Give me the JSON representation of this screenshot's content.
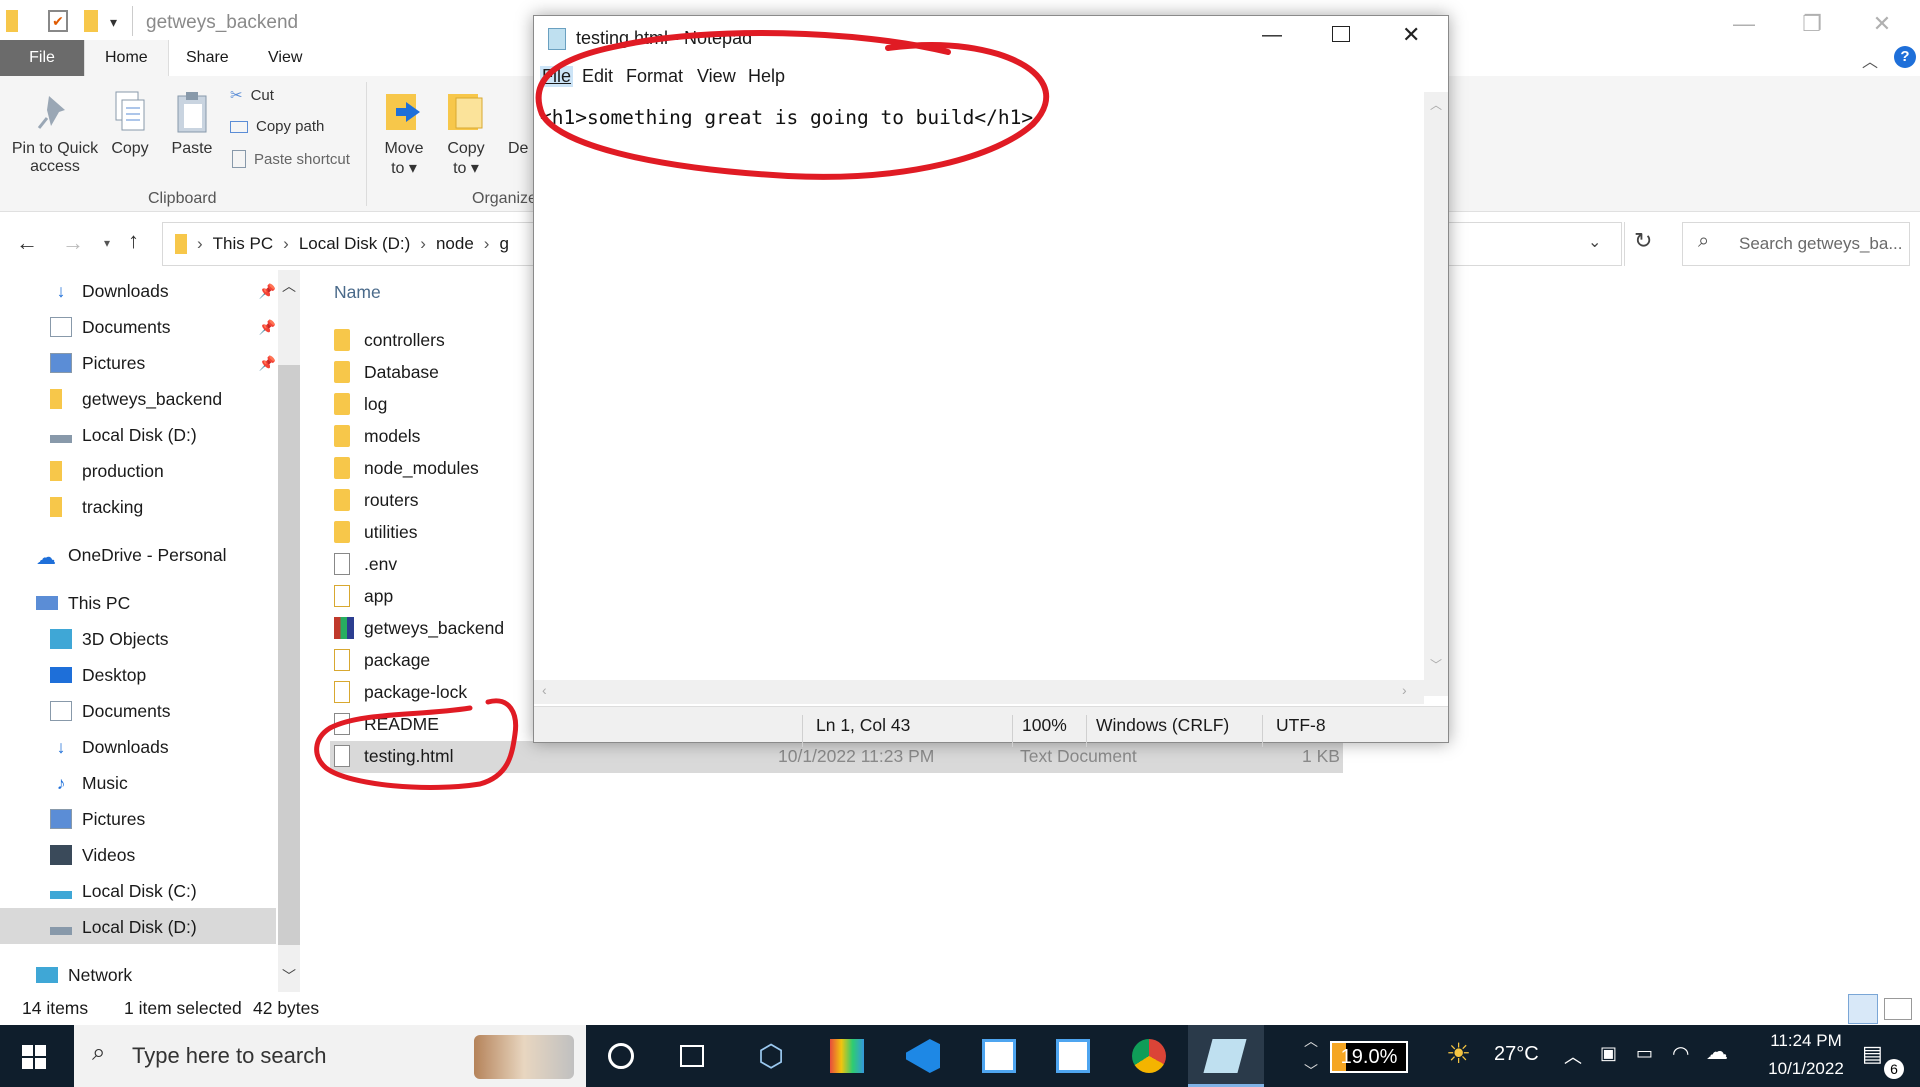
{
  "explorer": {
    "title": "getweys_backend",
    "tabs": {
      "file": "File",
      "home": "Home",
      "share": "Share",
      "view": "View"
    },
    "ribbon": {
      "pin": "Pin to Quick\naccess",
      "pin_l1": "Pin to Quick",
      "pin_l2": "access",
      "copy": "Copy",
      "paste": "Paste",
      "cut": "Cut",
      "copy_path": "Copy path",
      "paste_shortcut": "Paste shortcut",
      "clipboard": "Clipboard",
      "move_l1": "Move",
      "move_l2": "to",
      "copy_to_l1": "Copy",
      "copy_to_l2": "to",
      "de": "De",
      "organize": "Organize"
    },
    "address": {
      "this_pc": "This PC",
      "disk": "Local Disk (D:)",
      "node": "node",
      "g": "g"
    },
    "search_placeholder": "Search getweys_ba...",
    "nav": {
      "downloads": "Downloads",
      "documents": "Documents",
      "pictures": "Pictures",
      "getweys_backend": "getweys_backend",
      "local_d": "Local Disk (D:)",
      "production": "production",
      "tracking": "tracking",
      "onedrive": "OneDrive - Personal",
      "this_pc": "This PC",
      "objects3d": "3D Objects",
      "desktop": "Desktop",
      "documents2": "Documents",
      "downloads2": "Downloads",
      "music": "Music",
      "pictures2": "Pictures",
      "videos": "Videos",
      "local_c": "Local Disk (C:)",
      "local_d2": "Local Disk (D:)",
      "network": "Network"
    },
    "column_name": "Name",
    "files": [
      "controllers",
      "Database",
      "log",
      "models",
      "node_modules",
      "routers",
      "utilities",
      ".env",
      "app",
      "getweys_backend",
      "package",
      "package-lock",
      "README",
      "testing.html"
    ],
    "selected_details": {
      "date": "10/1/2022 11:23 PM",
      "type": "Text Document",
      "size": "1 KB"
    },
    "status": {
      "items": "14 items",
      "selected": "1 item selected",
      "bytes": "42 bytes"
    }
  },
  "notepad": {
    "title": "testing.html - Notepad",
    "menu": {
      "file": "File",
      "edit": "Edit",
      "format": "Format",
      "view": "View",
      "help": "Help"
    },
    "content": "<h1>something great is going to build</h1>",
    "status": {
      "pos": "Ln 1, Col 43",
      "zoom": "100%",
      "eol": "Windows (CRLF)",
      "enc": "UTF-8"
    }
  },
  "taskbar": {
    "search_placeholder": "Type here to search",
    "battery": "19.0%",
    "temp": "27°C",
    "time": "11:24 PM",
    "date": "10/1/2022",
    "notif_count": "6"
  },
  "colors": {
    "annotation": "#e01b24",
    "taskbar": "#0f1e2c",
    "selection": "#d9d9d9",
    "folder": "#f7c74a"
  }
}
